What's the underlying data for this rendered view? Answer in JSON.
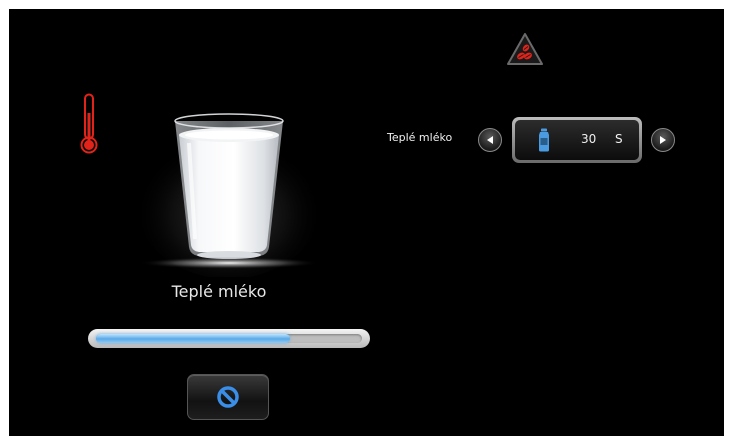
{
  "product": {
    "name": "Teplé mléko",
    "progress_fraction": 0.73
  },
  "setting": {
    "label": "Teplé mléko",
    "value": "30",
    "unit": "S"
  },
  "icons": {
    "warning": "coffee-beans-warning-icon",
    "thermometer": "thermometer-icon",
    "cancel": "cancel-icon",
    "milk": "milk-bottle-icon",
    "arrow_left": "arrow-left-icon",
    "arrow_right": "arrow-right-icon"
  },
  "colors": {
    "background": "#000000",
    "thermometer": "#e2231a",
    "progress": "#5aa9e6",
    "cancel_icon": "#3a8ee8",
    "milk_icon": "#4a9be0"
  }
}
